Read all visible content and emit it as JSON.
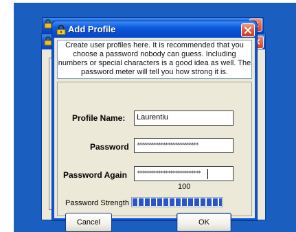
{
  "dialog": {
    "title": "Add Profile",
    "info_text": "Create user profiles here. It is recommended that you choose a password nobody can guess. Including numbers or special characters is a good idea as well. The password meter will tell you how strong it is.",
    "profile_name_label": "Profile Name:",
    "profile_name_value": "Laurentiu",
    "password_label": "Password",
    "password_mask": "**************************",
    "password_again_label": "Password Again",
    "password_again_mask": "***************************",
    "strength_value": "100",
    "strength_label": "Password Strength",
    "strength_fraction": 1.0,
    "cancel_label": "Cancel",
    "ok_label": "OK"
  },
  "colors": {
    "desktop": "#1a5fc0",
    "titlebar": "#0a55d8",
    "close_button": "#e0553a",
    "meter_fill": "#2a55c8",
    "dialog_face": "#ece9d8"
  },
  "icons": {
    "title_icon": "padlock-icon",
    "close_icon": "close-x-icon"
  }
}
